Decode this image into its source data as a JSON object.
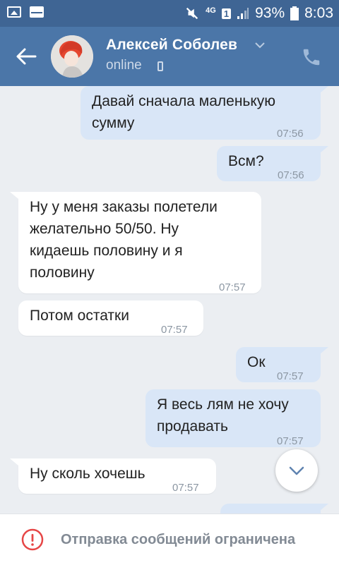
{
  "status_bar": {
    "network": "4G",
    "sim": "1",
    "battery": "93%",
    "time": "8:03"
  },
  "header": {
    "name": "Алексей Соболев",
    "status": "online"
  },
  "messages": [
    {
      "dir": "out",
      "text": "Давай сначала маленькую\nсумму",
      "time": "07:56"
    },
    {
      "dir": "out",
      "text": "Всм?",
      "time": "07:56"
    },
    {
      "dir": "in",
      "text": "Ну у меня заказы полетели\nжелательно 50/50. Ну\nкидаешь половину и я\nполовину",
      "time": "07:57"
    },
    {
      "dir": "in",
      "text": "Потом остатки",
      "time": "07:57"
    },
    {
      "dir": "out",
      "text": "Ок",
      "time": "07:57"
    },
    {
      "dir": "out",
      "text": "Я весь лям не хочу\nпродавать",
      "time": "07:57"
    },
    {
      "dir": "in",
      "text": "Ну сколь хочешь",
      "time": "07:57"
    }
  ],
  "composer": {
    "notice": "Отправка сообщений ограничена"
  },
  "colors": {
    "statusbar": "#3f6594",
    "header": "#4b76a8",
    "outgoing_bubble": "#d9e6f7",
    "incoming_bubble": "#ffffff",
    "warning": "#e64646"
  }
}
